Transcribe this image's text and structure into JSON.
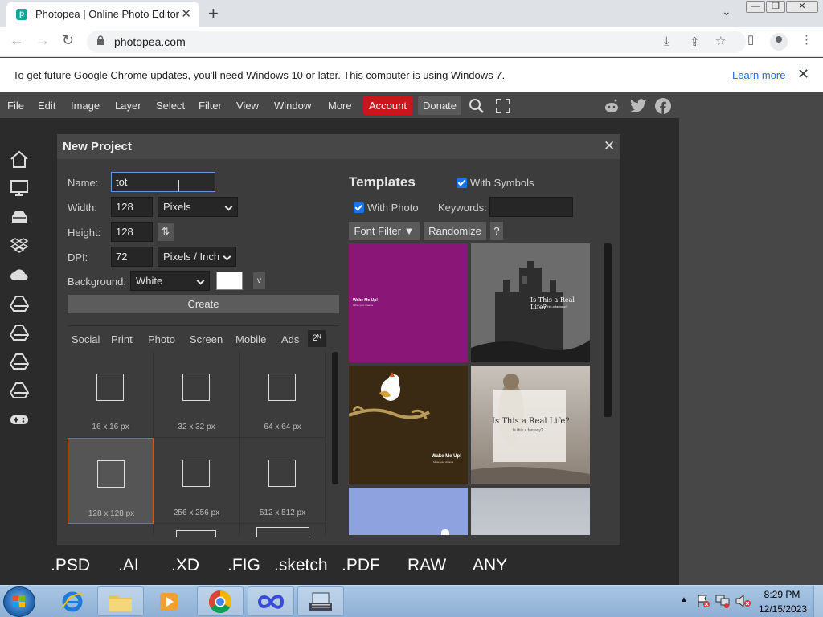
{
  "browser": {
    "tab_title": "Photopea | Online Photo Editor",
    "favicon_letter": "p",
    "url": "photopea.com",
    "new_tab": "+",
    "win_minimize": "—",
    "win_restore": "❐",
    "win_close": "✕"
  },
  "infobar": {
    "message": "To get future Google Chrome updates, you'll need Windows 10 or later. This computer is using Windows 7.",
    "learn_more": "Learn more"
  },
  "menu": {
    "items": [
      "File",
      "Edit",
      "Image",
      "Layer",
      "Select",
      "Filter",
      "View",
      "Window",
      "More"
    ],
    "account": "Account",
    "donate": "Donate"
  },
  "formats": [
    ".PSD",
    ".AI",
    ".XD",
    ".FIG",
    ".sketch",
    ".PDF",
    "RAW",
    "ANY"
  ],
  "dialog": {
    "title": "New Project",
    "name_label": "Name:",
    "name_value": "tot",
    "width_label": "Width:",
    "width_value": "128",
    "width_unit": "Pixels",
    "height_label": "Height:",
    "height_value": "128",
    "swap_symbol": "⇅",
    "dpi_label": "DPI:",
    "dpi_value": "72",
    "dpi_unit": "Pixels / Inch",
    "bg_label": "Background:",
    "bg_value": "White",
    "bg_color": "#ffffff",
    "bg_more": "v",
    "create": "Create",
    "preset_tabs": [
      "Social",
      "Print",
      "Photo",
      "Screen",
      "Mobile",
      "Ads"
    ],
    "preset_pow": "2ᴺ",
    "presets": [
      "16 x 16 px",
      "32 x 32 px",
      "64 x 64 px",
      "128 x 128 px",
      "256 x 256 px",
      "512 x 512 px"
    ],
    "selected_preset": "128 x 128 px",
    "templates_title": "Templates",
    "with_symbols": "With Symbols",
    "with_photo": "With Photo",
    "keywords_label": "Keywords:",
    "font_filter": "Font Filter ▼",
    "randomize": "Randomize",
    "help": "?",
    "templates": [
      {
        "line1": "Wake Me Up!",
        "line2": "follow your dreams"
      },
      {
        "line1": "Is This a Real Life?",
        "line2": "Is this a fantasy?"
      },
      {
        "line1": "Wake Me Up!",
        "line2": "follow your dreams"
      },
      {
        "line1": "Is This a Real Life?",
        "line2": "Is this a fantasy?"
      }
    ]
  },
  "taskbar": {
    "time": "8:29 PM",
    "date": "12/15/2023"
  },
  "colors": {
    "account_red": "#c8161d",
    "checkbox_blue": "#1a73e8",
    "selection_orange": "#d05a20"
  }
}
